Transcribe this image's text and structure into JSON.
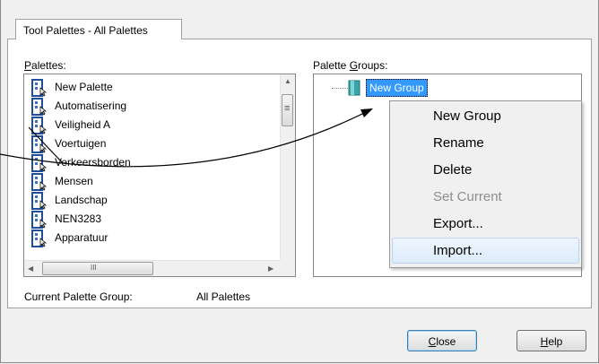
{
  "tab": {
    "label": "Tool Palettes - All Palettes"
  },
  "palettes": {
    "label_key": "P",
    "label_rest": "alettes:",
    "items": [
      "New Palette",
      "Automatisering",
      "Veiligheid A",
      "Voertuigen",
      "Verkeersborden",
      "Mensen",
      "Landschap",
      "NEN3283",
      "Apparatuur"
    ],
    "palette_icon": "palette-icon",
    "scroll_grip": "≡",
    "hscroll_grip": "III"
  },
  "groups": {
    "label_pre": "Palette ",
    "label_key": "G",
    "label_rest": "roups:",
    "tree_node": "New Group",
    "group_icon": "palette-group-icon"
  },
  "context_menu": {
    "items": [
      {
        "label": "New Group",
        "disabled": false
      },
      {
        "label": "Rename",
        "disabled": false
      },
      {
        "label": "Delete",
        "disabled": false
      },
      {
        "label": "Set Current",
        "disabled": true
      },
      {
        "label": "Export...",
        "disabled": false
      },
      {
        "label": "Import...",
        "disabled": false,
        "hover": true
      }
    ]
  },
  "current_group": {
    "label": "Current Palette Group:",
    "value": "All Palettes"
  },
  "buttons": {
    "close_key": "C",
    "close_rest": "lose",
    "help_key": "H",
    "help_rest": "elp"
  },
  "colors": {
    "selection": "#3399ff",
    "menu_hover": "#dcebfc",
    "disabled_text": "#8d8d8d"
  }
}
